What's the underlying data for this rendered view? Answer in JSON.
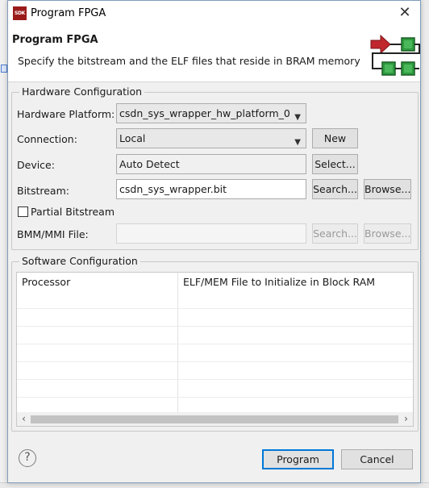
{
  "window": {
    "app_icon_text": "SDK",
    "title": "Program FPGA",
    "close_glyph": "✕"
  },
  "banner": {
    "title": "Program FPGA",
    "description": "Specify the bitstream and the ELF files that reside in BRAM memory",
    "graphic_icon": "fpga-program-arrow-icon"
  },
  "hardware": {
    "legend": "Hardware Configuration",
    "platform_label": "Hardware Platform:",
    "platform_value": "csdn_sys_wrapper_hw_platform_0",
    "connection_label": "Connection:",
    "connection_value": "Local",
    "new_button": "New",
    "device_label": "Device:",
    "device_value": "Auto Detect",
    "select_button": "Select...",
    "bitstream_label": "Bitstream:",
    "bitstream_value": "csdn_sys_wrapper.bit",
    "search_button": "Search...",
    "browse_button": "Browse...",
    "partial_label": "Partial Bitstream",
    "partial_checked": false,
    "bmm_label": "BMM/MMI File:",
    "bmm_value": "",
    "bmm_search_button": "Search...",
    "bmm_browse_button": "Browse..."
  },
  "software": {
    "legend": "Software Configuration",
    "columns": [
      "Processor",
      "ELF/MEM File to Initialize in Block RAM"
    ],
    "rows": []
  },
  "footer": {
    "help_glyph": "?",
    "program_button": "Program",
    "cancel_button": "Cancel"
  },
  "colors": {
    "accent_blue": "#0078d7",
    "icon_red": "#c0282d",
    "icon_green": "#2e9a3e"
  }
}
